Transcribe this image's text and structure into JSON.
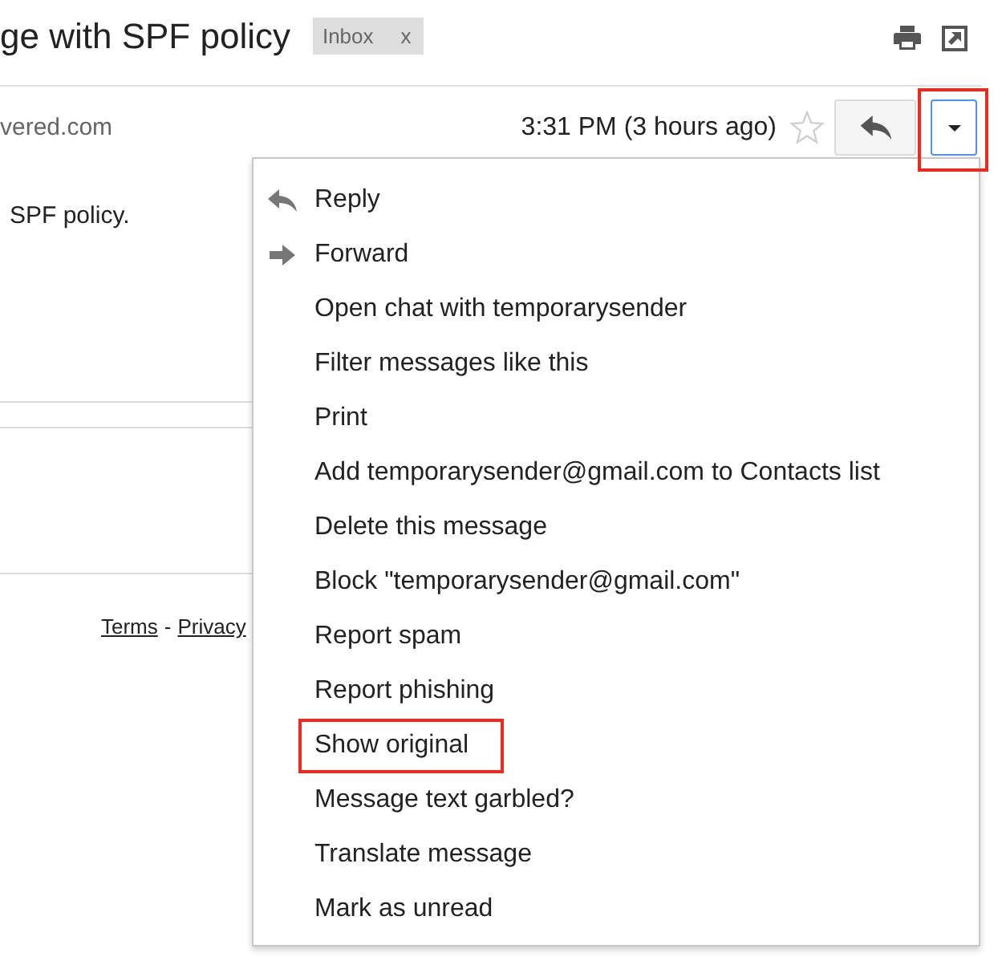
{
  "message": {
    "subject": "ge with SPF policy",
    "labels": [
      {
        "name": "Inbox",
        "remove": "x"
      }
    ]
  },
  "sender": {
    "address": "vered.com",
    "time": "3:31 PM (3 hours ago)",
    "starred": false
  },
  "actions": {
    "dropdown": {
      "focused": true,
      "highlighted": true
    }
  },
  "body": {
    "text": "SPF policy."
  },
  "footer": {
    "links": [
      "Terms",
      "Privacy"
    ],
    "separator": "-"
  },
  "menu": {
    "items": [
      {
        "label": "Reply",
        "kind": "reply",
        "highlighted": false
      },
      {
        "label": "Forward",
        "kind": "forward",
        "highlighted": false
      },
      {
        "label": "Open chat with temporarysender",
        "kind": "plain",
        "highlighted": false
      },
      {
        "label": "Filter messages like this",
        "kind": "plain",
        "highlighted": false
      },
      {
        "label": "Print",
        "kind": "plain",
        "highlighted": false
      },
      {
        "label": "Add temporarysender@gmail.com to Contacts list",
        "kind": "plain",
        "highlighted": false
      },
      {
        "label": "Delete this message",
        "kind": "plain",
        "highlighted": false
      },
      {
        "label": "Block \"temporarysender@gmail.com\"",
        "kind": "plain",
        "highlighted": false
      },
      {
        "label": "Report spam",
        "kind": "plain",
        "highlighted": false
      },
      {
        "label": "Report phishing",
        "kind": "plain",
        "highlighted": false
      },
      {
        "label": "Show original",
        "kind": "plain",
        "highlighted": true
      },
      {
        "label": "Message text garbled?",
        "kind": "plain",
        "highlighted": false
      },
      {
        "label": "Translate message",
        "kind": "plain",
        "highlighted": false
      },
      {
        "label": "Mark as unread",
        "kind": "plain",
        "highlighted": false
      }
    ]
  }
}
